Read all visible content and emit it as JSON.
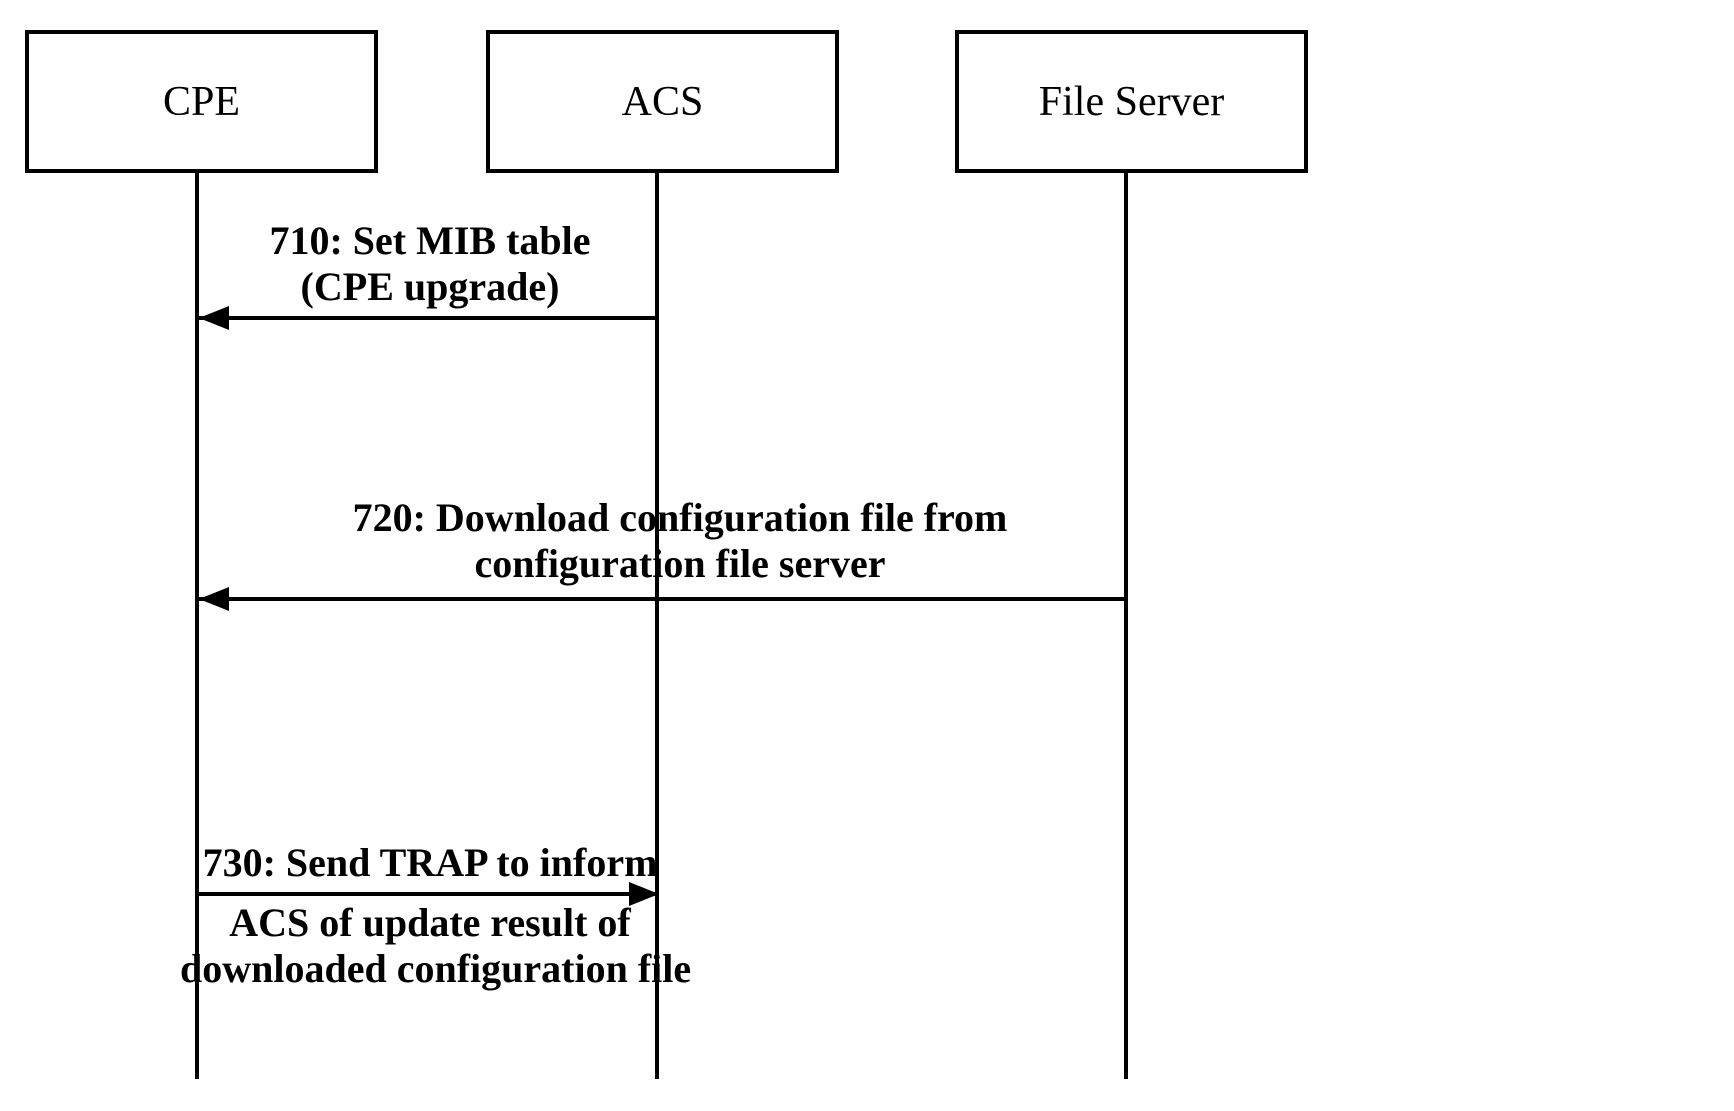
{
  "participants": {
    "cpe": "CPE",
    "acs": "ACS",
    "file_server": "File Server"
  },
  "messages": {
    "m1_line1": "710: Set MIB table",
    "m1_line2": "(CPE upgrade)",
    "m2_line1": "720: Download configuration file from",
    "m2_line2": "configuration file server",
    "m3_line1": "730: Send TRAP to inform",
    "m3_line2": "ACS of update  result of",
    "m3_line3": "downloaded configuration file"
  }
}
